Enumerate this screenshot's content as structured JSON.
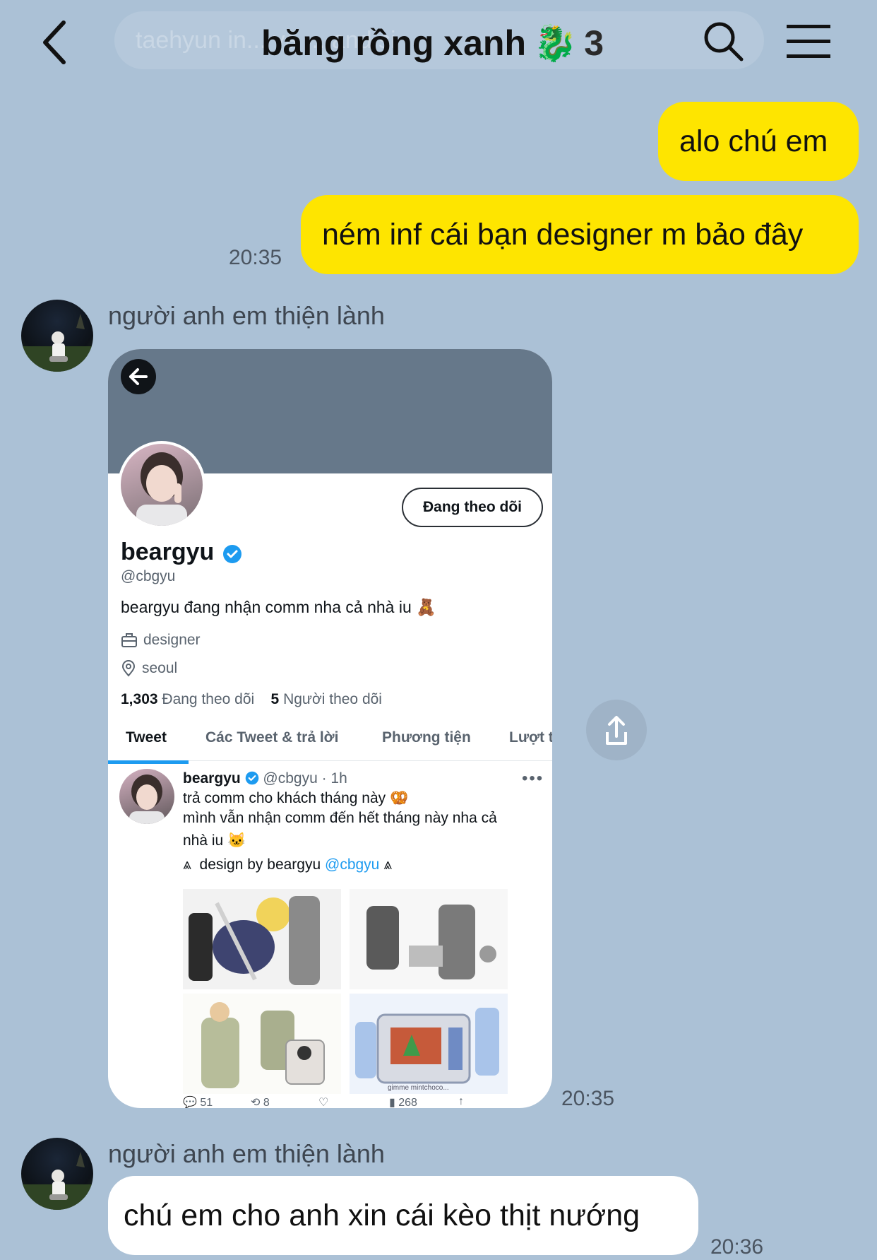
{
  "header": {
    "search_ghost_text": "taehyun in... và ... and si",
    "title": "băng rồng xanh",
    "title_emoji": "🐉",
    "member_count": "3",
    "icons": [
      "back-icon",
      "search-icon",
      "menu-icon"
    ]
  },
  "messages": {
    "m1": {
      "text": "alo chú em"
    },
    "m2": {
      "text": "ném inf cái bạn designer m bảo đây",
      "time": "20:35"
    },
    "m3": {
      "sender": "người anh em thiện lành",
      "time": "20:35"
    },
    "m4": {
      "sender": "người anh em thiện lành",
      "text": "chú em cho anh xin cái kèo thịt nướng",
      "time": "20:36"
    }
  },
  "profile": {
    "follow_button": "Đang theo dõi",
    "name": "beargyu",
    "handle": "@cbgyu",
    "bio": "beargyu đang nhận comm nha cả nhà iu 🧸",
    "work": "designer",
    "location": "seoul",
    "following_count": "1,303",
    "following_label": "Đang theo dõi",
    "followers_count": "5",
    "followers_label": "Người theo dõi",
    "tabs": [
      "Tweet",
      "Các Tweet & trả lời",
      "Phương tiện",
      "Lượt t"
    ]
  },
  "tweet": {
    "name": "beargyu",
    "handle": "@cbgyu",
    "age": "· 1h",
    "line1": "trả comm cho khách tháng này 🥨",
    "line2": "mình vẫn nhận comm đến hết tháng này nha cả",
    "line3": "nhà iu 🐱",
    "credit_prefix": "design by beargyu",
    "credit_mention": "@cbgyu",
    "media_caption": "gimme mintchoco...",
    "actions": [
      "51",
      "8",
      "",
      "268",
      ""
    ]
  },
  "colors": {
    "background": "#abc1d6",
    "my_bubble": "#fee500",
    "their_bubble": "#ffffff",
    "twitter_blue": "#1d9bf0"
  }
}
